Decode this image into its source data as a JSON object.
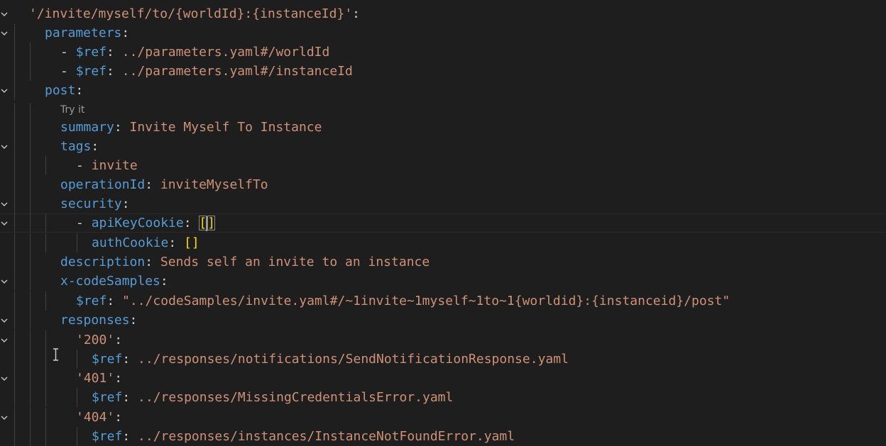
{
  "editor": {
    "language": "yaml",
    "codelens": {
      "label": "Try it"
    },
    "lines": [
      {
        "n": 1,
        "fold": true,
        "tokens": [
          {
            "t": "s",
            "v": "'/invite/myself/to/{worldId}:{instanceId}'"
          },
          {
            "t": "p",
            "v": ":"
          }
        ]
      },
      {
        "n": 2,
        "fold": true,
        "tokens": [
          {
            "t": "k",
            "v": "parameters"
          },
          {
            "t": "p",
            "v": ":"
          }
        ]
      },
      {
        "n": 3,
        "fold": false,
        "tokens": [
          {
            "t": "p",
            "v": "- "
          },
          {
            "t": "k",
            "v": "$ref"
          },
          {
            "t": "p",
            "v": ": "
          },
          {
            "t": "s",
            "v": "../parameters.yaml#/worldId"
          }
        ]
      },
      {
        "n": 4,
        "fold": false,
        "tokens": [
          {
            "t": "p",
            "v": "- "
          },
          {
            "t": "k",
            "v": "$ref"
          },
          {
            "t": "p",
            "v": ": "
          },
          {
            "t": "s",
            "v": "../parameters.yaml#/instanceId"
          }
        ]
      },
      {
        "n": 5,
        "fold": true,
        "tokens": [
          {
            "t": "k",
            "v": "post"
          },
          {
            "t": "p",
            "v": ":"
          }
        ]
      },
      {
        "n": 6,
        "fold": false,
        "tokens": [
          {
            "t": "k",
            "v": "summary"
          },
          {
            "t": "p",
            "v": ": "
          },
          {
            "t": "s",
            "v": "Invite Myself To Instance"
          }
        ]
      },
      {
        "n": 7,
        "fold": true,
        "tokens": [
          {
            "t": "k",
            "v": "tags"
          },
          {
            "t": "p",
            "v": ":"
          }
        ]
      },
      {
        "n": 8,
        "fold": false,
        "tokens": [
          {
            "t": "p",
            "v": "- "
          },
          {
            "t": "s",
            "v": "invite"
          }
        ]
      },
      {
        "n": 9,
        "fold": false,
        "tokens": [
          {
            "t": "k",
            "v": "operationId"
          },
          {
            "t": "p",
            "v": ": "
          },
          {
            "t": "s",
            "v": "inviteMyselfTo"
          }
        ]
      },
      {
        "n": 10,
        "fold": true,
        "tokens": [
          {
            "t": "k",
            "v": "security"
          },
          {
            "t": "p",
            "v": ":"
          }
        ]
      },
      {
        "n": 11,
        "fold": true,
        "tokens": [
          {
            "t": "p",
            "v": "- "
          },
          {
            "t": "k",
            "v": "apiKeyCookie"
          },
          {
            "t": "p",
            "v": ": "
          },
          {
            "t": "brm",
            "v": "["
          },
          {
            "t": "caret",
            "v": ""
          },
          {
            "t": "brm",
            "v": "]"
          }
        ]
      },
      {
        "n": 12,
        "fold": false,
        "tokens": [
          {
            "t": "k",
            "v": "authCookie"
          },
          {
            "t": "p",
            "v": ": "
          },
          {
            "t": "br",
            "v": "[]"
          }
        ]
      },
      {
        "n": 13,
        "fold": false,
        "tokens": [
          {
            "t": "k",
            "v": "description"
          },
          {
            "t": "p",
            "v": ": "
          },
          {
            "t": "s",
            "v": "Sends self an invite to an instance"
          }
        ]
      },
      {
        "n": 14,
        "fold": true,
        "tokens": [
          {
            "t": "k",
            "v": "x-codeSamples"
          },
          {
            "t": "p",
            "v": ":"
          }
        ]
      },
      {
        "n": 15,
        "fold": false,
        "tokens": [
          {
            "t": "k",
            "v": "$ref"
          },
          {
            "t": "p",
            "v": ": "
          },
          {
            "t": "s",
            "v": "\"../codeSamples/invite.yaml#/~1invite~1myself~1to~1{worldid}:{instanceid}/post\""
          }
        ]
      },
      {
        "n": 16,
        "fold": true,
        "tokens": [
          {
            "t": "k",
            "v": "responses"
          },
          {
            "t": "p",
            "v": ":"
          }
        ]
      },
      {
        "n": 17,
        "fold": true,
        "tokens": [
          {
            "t": "s",
            "v": "'200'"
          },
          {
            "t": "p",
            "v": ":"
          }
        ]
      },
      {
        "n": 18,
        "fold": false,
        "tokens": [
          {
            "t": "k",
            "v": "$ref"
          },
          {
            "t": "p",
            "v": ": "
          },
          {
            "t": "s",
            "v": "../responses/notifications/SendNotificationResponse.yaml"
          }
        ]
      },
      {
        "n": 19,
        "fold": true,
        "tokens": [
          {
            "t": "s",
            "v": "'401'"
          },
          {
            "t": "p",
            "v": ":"
          }
        ]
      },
      {
        "n": 20,
        "fold": false,
        "tokens": [
          {
            "t": "k",
            "v": "$ref"
          },
          {
            "t": "p",
            "v": ": "
          },
          {
            "t": "s",
            "v": "../responses/MissingCredentialsError.yaml"
          }
        ]
      },
      {
        "n": 21,
        "fold": true,
        "tokens": [
          {
            "t": "s",
            "v": "'404'"
          },
          {
            "t": "p",
            "v": ":"
          }
        ]
      },
      {
        "n": 22,
        "fold": false,
        "tokens": [
          {
            "t": "k",
            "v": "$ref"
          },
          {
            "t": "p",
            "v": ": "
          },
          {
            "t": "s",
            "v": "../responses/instances/InstanceNotFoundError.yaml"
          }
        ]
      }
    ]
  }
}
